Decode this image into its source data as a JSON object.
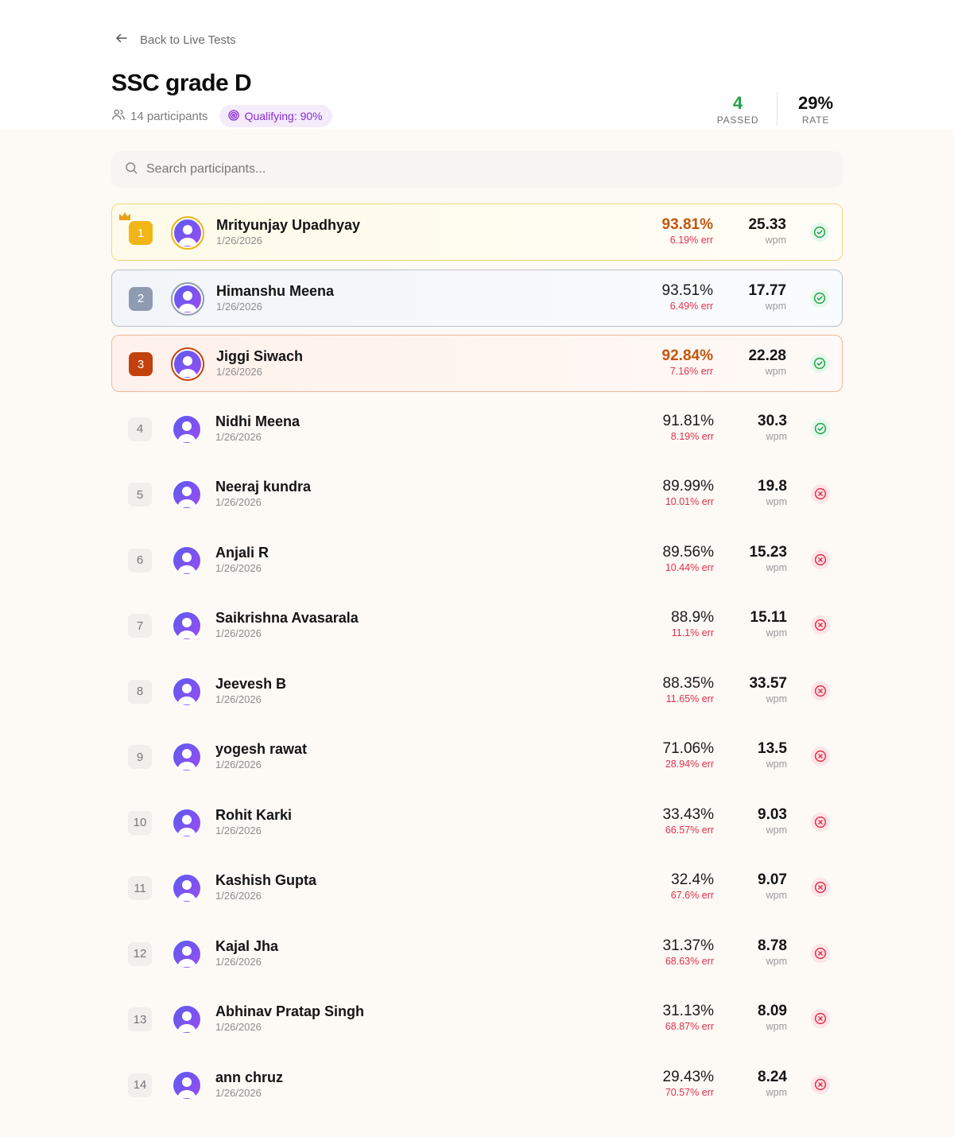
{
  "nav": {
    "back_label": "Back to Live Tests"
  },
  "header": {
    "title": "SSC grade D",
    "participants_label": "14 participants",
    "qualifying_label": "Qualifying: 90%"
  },
  "stats": {
    "passed_value": "4",
    "passed_label": "PASSED",
    "rate_value": "29%",
    "rate_label": "RATE"
  },
  "search": {
    "placeholder": "Search participants..."
  },
  "colors": {
    "pass": "#22a34a",
    "fail": "#e0314b",
    "gold": "#f2b516",
    "silver": "#8e9bb0",
    "bronze": "#c2410c",
    "accent": "#8a2bd6"
  },
  "participants": [
    {
      "rank": "1",
      "name": "Mrityunjay Upadhyay",
      "date": "1/26/2026",
      "accuracy": "93.81%",
      "error": "6.19% err",
      "wpm": "25.33",
      "wpm_unit": "wpm",
      "status": "pass"
    },
    {
      "rank": "2",
      "name": "Himanshu Meena",
      "date": "1/26/2026",
      "accuracy": "93.51%",
      "error": "6.49% err",
      "wpm": "17.77",
      "wpm_unit": "wpm",
      "status": "pass"
    },
    {
      "rank": "3",
      "name": "Jiggi Siwach",
      "date": "1/26/2026",
      "accuracy": "92.84%",
      "error": "7.16% err",
      "wpm": "22.28",
      "wpm_unit": "wpm",
      "status": "pass"
    },
    {
      "rank": "4",
      "name": "Nidhi Meena",
      "date": "1/26/2026",
      "accuracy": "91.81%",
      "error": "8.19% err",
      "wpm": "30.3",
      "wpm_unit": "wpm",
      "status": "pass"
    },
    {
      "rank": "5",
      "name": "Neeraj kundra",
      "date": "1/26/2026",
      "accuracy": "89.99%",
      "error": "10.01% err",
      "wpm": "19.8",
      "wpm_unit": "wpm",
      "status": "fail"
    },
    {
      "rank": "6",
      "name": "Anjali R",
      "date": "1/26/2026",
      "accuracy": "89.56%",
      "error": "10.44% err",
      "wpm": "15.23",
      "wpm_unit": "wpm",
      "status": "fail"
    },
    {
      "rank": "7",
      "name": "Saikrishna Avasarala",
      "date": "1/26/2026",
      "accuracy": "88.9%",
      "error": "11.1% err",
      "wpm": "15.11",
      "wpm_unit": "wpm",
      "status": "fail"
    },
    {
      "rank": "8",
      "name": "Jeevesh B",
      "date": "1/26/2026",
      "accuracy": "88.35%",
      "error": "11.65% err",
      "wpm": "33.57",
      "wpm_unit": "wpm",
      "status": "fail"
    },
    {
      "rank": "9",
      "name": "yogesh rawat",
      "date": "1/26/2026",
      "accuracy": "71.06%",
      "error": "28.94% err",
      "wpm": "13.5",
      "wpm_unit": "wpm",
      "status": "fail"
    },
    {
      "rank": "10",
      "name": "Rohit Karki",
      "date": "1/26/2026",
      "accuracy": "33.43%",
      "error": "66.57% err",
      "wpm": "9.03",
      "wpm_unit": "wpm",
      "status": "fail"
    },
    {
      "rank": "11",
      "name": "Kashish Gupta",
      "date": "1/26/2026",
      "accuracy": "32.4%",
      "error": "67.6% err",
      "wpm": "9.07",
      "wpm_unit": "wpm",
      "status": "fail"
    },
    {
      "rank": "12",
      "name": "Kajal Jha",
      "date": "1/26/2026",
      "accuracy": "31.37%",
      "error": "68.63% err",
      "wpm": "8.78",
      "wpm_unit": "wpm",
      "status": "fail"
    },
    {
      "rank": "13",
      "name": "Abhinav Pratap Singh",
      "date": "1/26/2026",
      "accuracy": "31.13%",
      "error": "68.87% err",
      "wpm": "8.09",
      "wpm_unit": "wpm",
      "status": "fail"
    },
    {
      "rank": "14",
      "name": "ann chruz",
      "date": "1/26/2026",
      "accuracy": "29.43%",
      "error": "70.57% err",
      "wpm": "8.24",
      "wpm_unit": "wpm",
      "status": "fail"
    }
  ]
}
